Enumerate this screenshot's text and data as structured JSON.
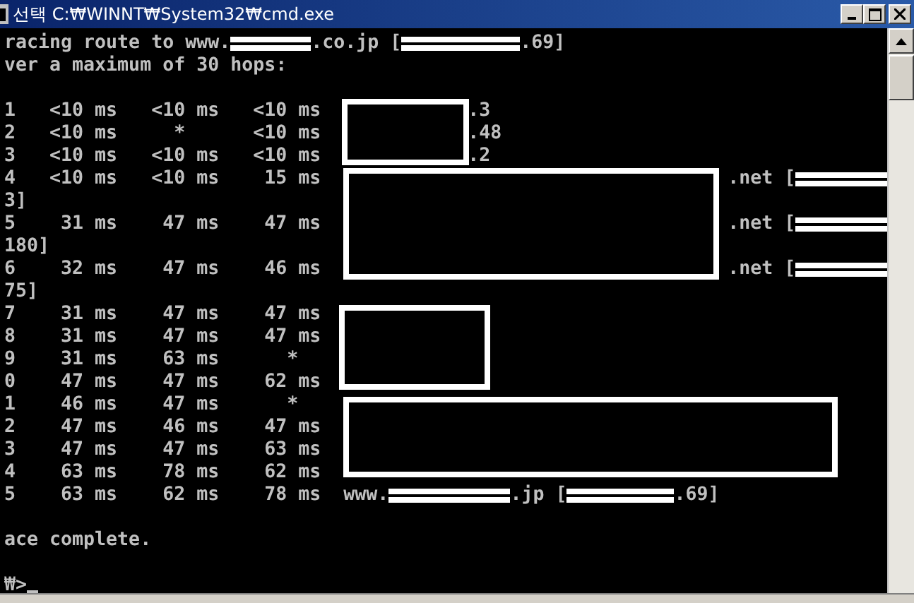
{
  "window": {
    "title": "선택 C:₩WINNT₩System32₩cmd.exe"
  },
  "console": {
    "lines": [
      {
        "kind": "output",
        "parts": [
          {
            "kind": "text",
            "text": "racing route to www."
          },
          {
            "kind": "redacted"
          },
          {
            "kind": "text",
            "text": ".co.jp ["
          },
          {
            "kind": "redacted"
          },
          {
            "kind": "text",
            "text": ".69]"
          }
        ]
      },
      {
        "kind": "output",
        "parts": [
          {
            "kind": "text",
            "text": "ver a maximum of 30 hops:"
          }
        ]
      },
      {
        "kind": "blank"
      },
      {
        "kind": "output",
        "parts": [
          {
            "kind": "text",
            "text": "1   <10 ms   <10 ms   <10 ms"
          },
          {
            "kind": "tail",
            "text": ".3"
          }
        ]
      },
      {
        "kind": "output",
        "parts": [
          {
            "kind": "text",
            "text": "2   <10 ms     *      <10 ms"
          },
          {
            "kind": "tail",
            "text": ".48"
          }
        ]
      },
      {
        "kind": "output",
        "parts": [
          {
            "kind": "text",
            "text": "3   <10 ms   <10 ms   <10 ms"
          },
          {
            "kind": "tail",
            "text": ".2"
          }
        ]
      },
      {
        "kind": "output",
        "parts": [
          {
            "kind": "text",
            "text": "4   <10 ms   <10 ms    15 ms"
          },
          {
            "kind": "tail",
            "text": ".net ["
          },
          {
            "kind": "redacted"
          }
        ]
      },
      {
        "kind": "output",
        "parts": [
          {
            "kind": "text",
            "text": "3]"
          }
        ]
      },
      {
        "kind": "output",
        "parts": [
          {
            "kind": "text",
            "text": "5    31 ms    47 ms    47 ms"
          },
          {
            "kind": "tail",
            "text": ".net ["
          },
          {
            "kind": "redacted"
          }
        ]
      },
      {
        "kind": "output",
        "parts": [
          {
            "kind": "text",
            "text": "180]"
          }
        ]
      },
      {
        "kind": "output",
        "parts": [
          {
            "kind": "text",
            "text": "6    32 ms    47 ms    46 ms"
          },
          {
            "kind": "tail",
            "text": ".net ["
          },
          {
            "kind": "redacted"
          }
        ]
      },
      {
        "kind": "output",
        "parts": [
          {
            "kind": "text",
            "text": "75]"
          }
        ]
      },
      {
        "kind": "output",
        "parts": [
          {
            "kind": "text",
            "text": "7    31 ms    47 ms    47 ms"
          }
        ]
      },
      {
        "kind": "output",
        "parts": [
          {
            "kind": "text",
            "text": "8    31 ms    47 ms    47 ms"
          }
        ]
      },
      {
        "kind": "output",
        "parts": [
          {
            "kind": "text",
            "text": "9    31 ms    63 ms      *"
          }
        ]
      },
      {
        "kind": "output",
        "parts": [
          {
            "kind": "text",
            "text": "0    47 ms    47 ms    62 ms"
          }
        ]
      },
      {
        "kind": "output",
        "parts": [
          {
            "kind": "text",
            "text": "1    46 ms    47 ms      *"
          }
        ]
      },
      {
        "kind": "output",
        "parts": [
          {
            "kind": "text",
            "text": "2    47 ms    46 ms    47 ms"
          }
        ]
      },
      {
        "kind": "output",
        "parts": [
          {
            "kind": "text",
            "text": "3    47 ms    47 ms    63 ms"
          }
        ]
      },
      {
        "kind": "output",
        "parts": [
          {
            "kind": "text",
            "text": "4    63 ms    78 ms    62 ms"
          }
        ]
      },
      {
        "kind": "output",
        "parts": [
          {
            "kind": "text",
            "text": "5    63 ms    62 ms    78 ms"
          },
          {
            "kind": "tail",
            "text": "www."
          },
          {
            "kind": "redacted"
          },
          {
            "kind": "text",
            "text": ".jp ["
          },
          {
            "kind": "redacted"
          },
          {
            "kind": "text",
            "text": ".69]"
          }
        ]
      },
      {
        "kind": "blank"
      },
      {
        "kind": "output",
        "parts": [
          {
            "kind": "text",
            "text": "ace complete."
          }
        ]
      },
      {
        "kind": "blank"
      },
      {
        "kind": "output",
        "parts": [
          {
            "kind": "text",
            "text": "₩>"
          },
          {
            "kind": "cursor"
          }
        ]
      }
    ]
  }
}
